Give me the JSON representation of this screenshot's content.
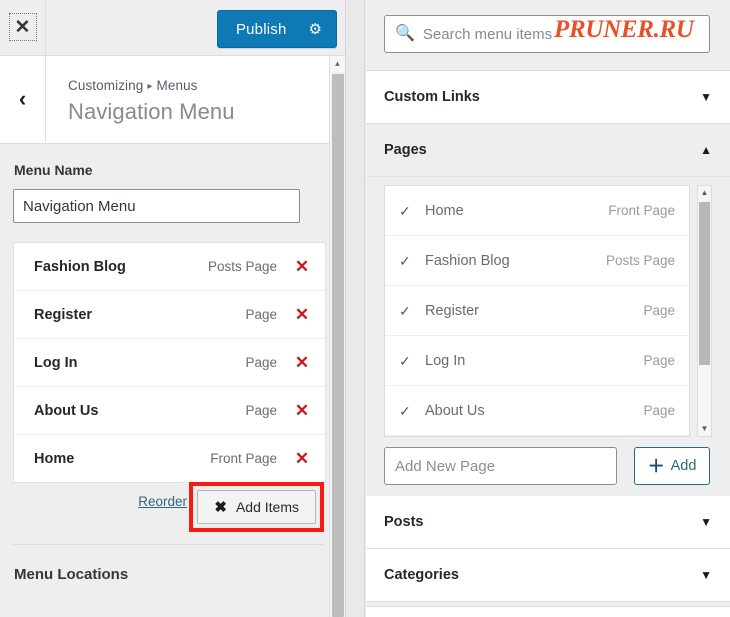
{
  "topbar": {
    "close_icon": "close-icon",
    "publish_label": "Publish",
    "gear_icon": "gear-icon",
    "accent_color": "#0d7ab5"
  },
  "header": {
    "back_icon": "chevron-left-icon",
    "breadcrumb_root": "Customizing",
    "breadcrumb_separator": "▸",
    "breadcrumb_current": "Menus",
    "title": "Navigation Menu"
  },
  "menu_name": {
    "label": "Menu Name",
    "value": "Navigation Menu"
  },
  "menu_items": [
    {
      "title": "Fashion Blog",
      "type": "Posts Page",
      "remove_icon": "✕"
    },
    {
      "title": "Register",
      "type": "Page",
      "remove_icon": "✕"
    },
    {
      "title": "Log In",
      "type": "Page",
      "remove_icon": "✕"
    },
    {
      "title": "About Us",
      "type": "Page",
      "remove_icon": "✕"
    },
    {
      "title": "Home",
      "type": "Front Page",
      "remove_icon": "✕"
    }
  ],
  "actions": {
    "reorder_label": "Reorder",
    "add_items_label": "Add Items",
    "add_items_icon": "✖",
    "highlight_color": "#f61a12"
  },
  "menu_locations": {
    "label": "Menu Locations"
  },
  "search": {
    "placeholder": "Search menu items",
    "icon": "search-icon",
    "value": ""
  },
  "watermark": {
    "text": "PRUNER.RU",
    "color": "#e8502a"
  },
  "accordions": [
    {
      "label": "Custom Links",
      "caret": "▼",
      "expanded": false
    },
    {
      "label": "Pages",
      "caret": "▲",
      "expanded": true
    },
    {
      "label": "Posts",
      "caret": "▼",
      "expanded": false
    },
    {
      "label": "Categories",
      "caret": "▼",
      "expanded": false
    }
  ],
  "pages_list": [
    {
      "check": "✓",
      "title": "Home",
      "type": "Front Page"
    },
    {
      "check": "✓",
      "title": "Fashion Blog",
      "type": "Posts Page"
    },
    {
      "check": "✓",
      "title": "Register",
      "type": "Page"
    },
    {
      "check": "✓",
      "title": "Log In",
      "type": "Page"
    },
    {
      "check": "✓",
      "title": "About Us",
      "type": "Page"
    }
  ],
  "add_new_page": {
    "placeholder": "Add New Page",
    "value": "",
    "button_label": "Add",
    "button_icon": "＋"
  },
  "scrollbars": {
    "up_arrow": "▲",
    "down_arrow": "▼"
  }
}
